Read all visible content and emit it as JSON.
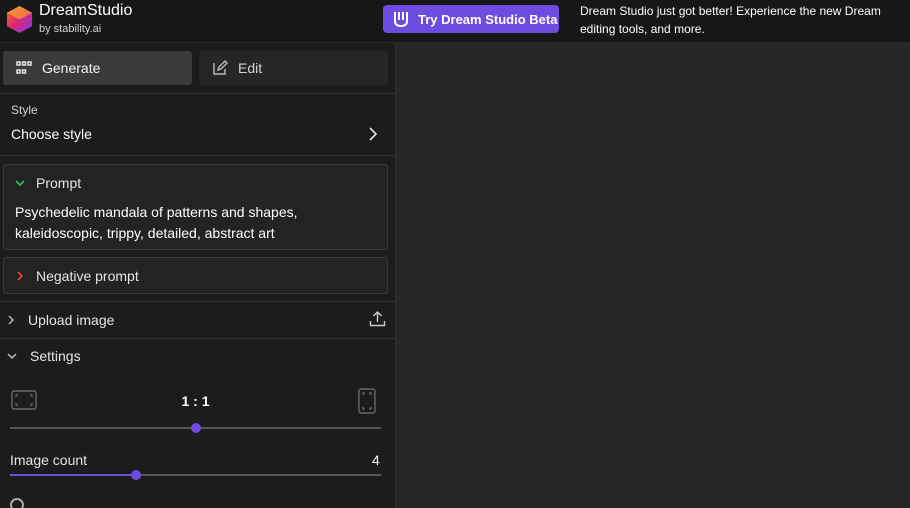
{
  "header": {
    "brand_title": "DreamStudio",
    "brand_subtitle": "by stability.ai",
    "beta_button_label": "Try Dream Studio Beta",
    "announcement": "Dream Studio just got better! Experience the new Dream editing tools, and more."
  },
  "tabs": {
    "generate_label": "Generate",
    "edit_label": "Edit"
  },
  "style": {
    "label": "Style",
    "value": "Choose style"
  },
  "prompt": {
    "label": "Prompt",
    "text": "Psychedelic mandala of patterns and shapes, kaleidoscopic, trippy, detailed, abstract art"
  },
  "negative_prompt": {
    "label": "Negative prompt"
  },
  "upload": {
    "label": "Upload image"
  },
  "settings": {
    "label": "Settings",
    "aspect_ratio": "1 : 1",
    "aspect_ratio_slider_fraction": 0.5,
    "image_count_label": "Image count",
    "image_count_value": "4",
    "image_count_slider_fraction": 0.34
  },
  "colors": {
    "accent": "#6d4ce0",
    "panel_bg": "#1c1c1c",
    "canvas_bg": "#272727"
  },
  "icons": {
    "logo": "dreamstudio-logo-icon",
    "beta": "stability-hand-icon",
    "generate": "grid-icon",
    "edit": "edit-icon",
    "style": "chevron-right-icon",
    "prompt": "chevron-down-icon",
    "negative_prompt": "chevron-right-icon",
    "upload_toggle": "chevron-right-icon",
    "upload": "upload-icon",
    "settings": "chevron-down-icon",
    "landscape": "landscape-frame-icon",
    "portrait": "portrait-frame-icon"
  }
}
